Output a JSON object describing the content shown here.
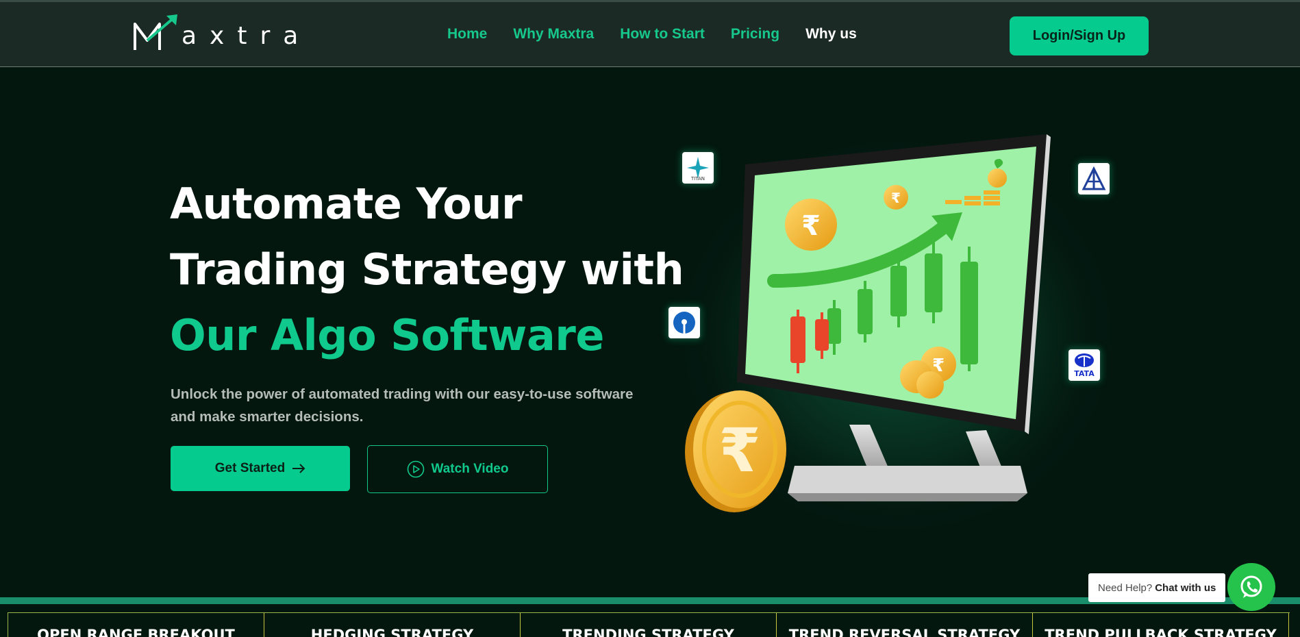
{
  "brand": {
    "name": "axtra",
    "logo_icon": "m-arrow-logo-icon"
  },
  "nav": {
    "links": [
      {
        "label": "Home"
      },
      {
        "label": "Why Maxtra"
      },
      {
        "label": "How to Start"
      },
      {
        "label": "Pricing"
      },
      {
        "label": "Why us",
        "active": true
      }
    ],
    "login_label": "Login/Sign Up"
  },
  "hero": {
    "title_line1": "Automate Your",
    "title_line2": "Trading Strategy with",
    "title_line3": "Our Algo Software",
    "description": "Unlock the power of automated trading with our easy-to-use software and make smarter decisions.",
    "primary_button": "Get Started",
    "primary_icon": "arrow-right-icon",
    "secondary_button": "Watch Video",
    "secondary_icon": "play-circle-icon"
  },
  "illustration": {
    "badges": [
      {
        "name": "titan-logo",
        "text": "TITAN"
      },
      {
        "name": "indian-oil-logo",
        "text": ""
      },
      {
        "name": "sbi-logo",
        "text": ""
      },
      {
        "name": "tata-logo",
        "text": "TATA"
      }
    ],
    "coin_symbol": "₹"
  },
  "strategies": [
    "OPEN RANGE BREAKOUT",
    "HEDGING STRATEGY",
    "TRENDING STRATEGY",
    "TREND REVERSAL STRATEGY",
    "TREND PULLBACK STRATEGY"
  ],
  "help": {
    "prefix": "Need Help?",
    "cta": "Chat with us",
    "icon": "whatsapp-icon"
  },
  "colors": {
    "accent": "#05cc8e",
    "background": "#03170f",
    "navbar": "#1c2a25",
    "screen": "#9ef1a6"
  }
}
